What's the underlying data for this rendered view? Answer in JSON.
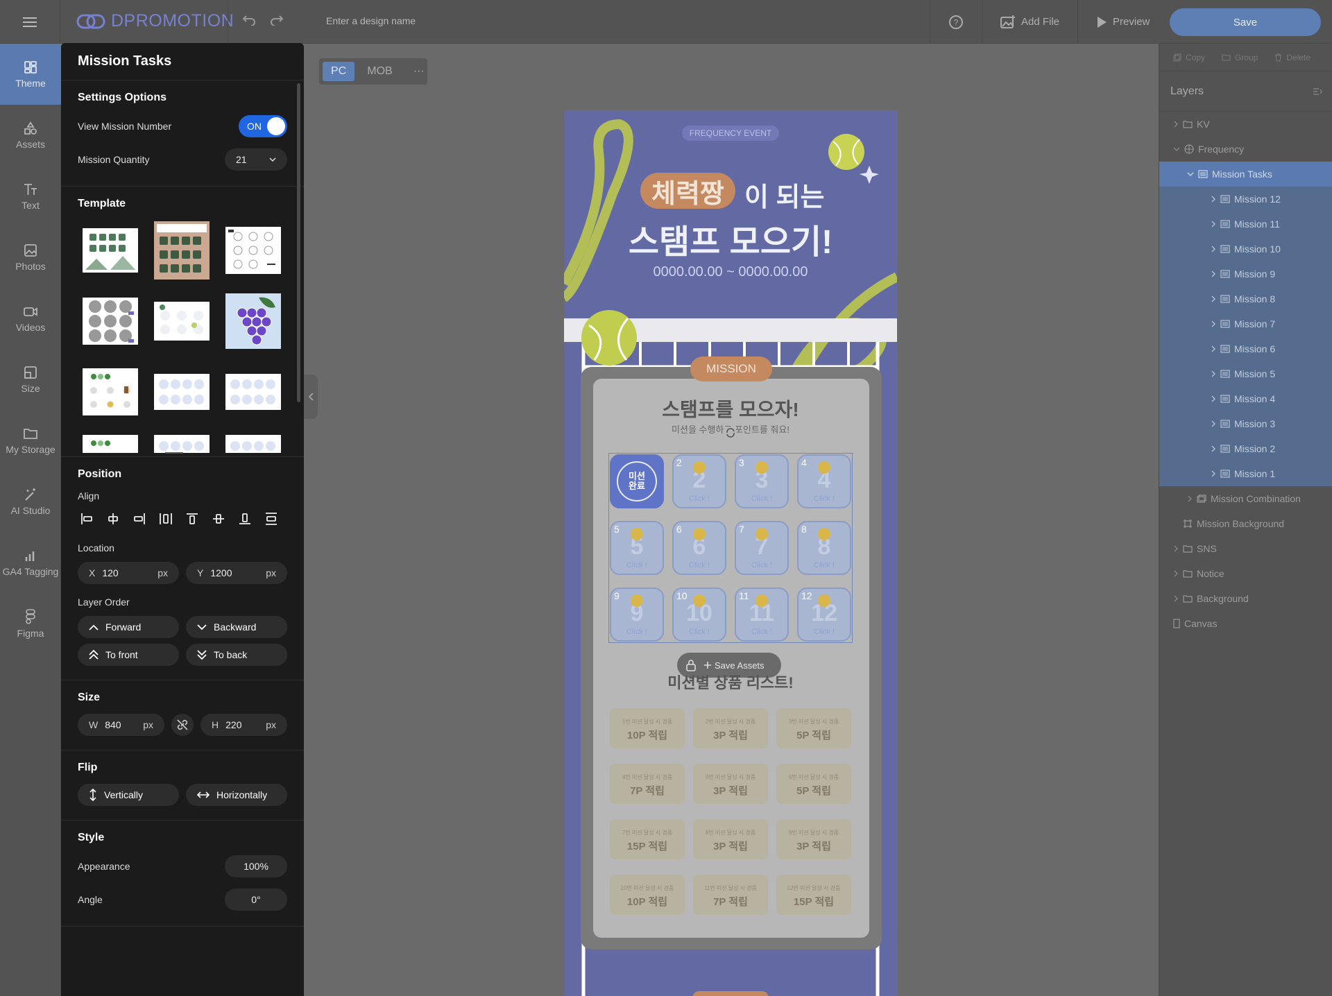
{
  "app": {
    "name": "DPROMOTION"
  },
  "topbar": {
    "design_name_placeholder": "Enter a design name",
    "add_file": "Add File",
    "preview": "Preview",
    "save": "Save"
  },
  "leftnav": {
    "items": [
      {
        "label": "Theme",
        "icon": "theme-icon"
      },
      {
        "label": "Assets",
        "icon": "assets-icon"
      },
      {
        "label": "Text",
        "icon": "text-icon"
      },
      {
        "label": "Photos",
        "icon": "photos-icon"
      },
      {
        "label": "Videos",
        "icon": "videos-icon"
      },
      {
        "label": "Size",
        "icon": "size-icon"
      },
      {
        "label": "My Storage",
        "icon": "folder-icon"
      },
      {
        "label": "AI Studio",
        "icon": "magic-wand-icon"
      },
      {
        "label": "GA4 Tagging",
        "icon": "bar-chart-icon"
      },
      {
        "label": "Figma",
        "icon": "figma-icon"
      }
    ]
  },
  "panel": {
    "title": "Mission Tasks",
    "settings": {
      "title": "Settings Options",
      "view_mission_number_label": "View Mission Number",
      "view_mission_number_state": "ON",
      "mission_quantity_label": "Mission Quantity",
      "mission_quantity_value": "21"
    },
    "template": {
      "title": "Template"
    },
    "position": {
      "title": "Position",
      "align_label": "Align",
      "location_label": "Location",
      "x_prefix": "X",
      "x_value": "120",
      "x_unit": "px",
      "y_prefix": "Y",
      "y_value": "1200",
      "y_unit": "px",
      "layer_order_label": "Layer Order",
      "forward": "Forward",
      "backward": "Backward",
      "to_front": "To front",
      "to_back": "To back"
    },
    "size": {
      "title": "Size",
      "w_prefix": "W",
      "w_value": "840",
      "w_unit": "px",
      "h_prefix": "H",
      "h_value": "220",
      "h_unit": "px"
    },
    "flip": {
      "title": "Flip",
      "vertically": "Vertically",
      "horizontally": "Horizontally"
    },
    "style": {
      "title": "Style",
      "appearance_label": "Appearance",
      "appearance_value": "100%",
      "angle_label": "Angle",
      "angle_value": "0°"
    }
  },
  "view_toggle": {
    "pc": "PC",
    "mob": "MOB",
    "more": "···"
  },
  "canvas": {
    "event_tag": "FREQUENCY EVENT",
    "headline_highlight": "체력짱",
    "headline_rest": "이 되는",
    "headline_line2": "스탬프 모으기!",
    "date_range": "0000.00.00 ~ 0000.00.00",
    "mission_tab": "MISSION",
    "card_title": "스탬프를 모으자!",
    "card_sub": "미션을 수행하고 포인트를 줘요!",
    "completed_stamp": "미션\n완료",
    "click_label": "Click !",
    "missions": [
      "2",
      "3",
      "4",
      "5",
      "6",
      "7",
      "8",
      "9",
      "10",
      "11",
      "12"
    ],
    "save_assets": "Save Assets",
    "list_title": "미션별 상품 리스트!",
    "rewards": [
      {
        "cond": "1번 미션 달성 시 경품",
        "prize": "10P 적립"
      },
      {
        "cond": "2번 미션 달성 시 경품",
        "prize": "3P 적립"
      },
      {
        "cond": "3번 미션 달성 시 경품",
        "prize": "5P 적립"
      },
      {
        "cond": "4번 미션 달성 시 경품",
        "prize": "7P 적립"
      },
      {
        "cond": "5번 미션 달성 시 경품",
        "prize": "3P 적립"
      },
      {
        "cond": "6번 미션 달성 시 경품",
        "prize": "5P 적립"
      },
      {
        "cond": "7번 미션 달성 시 경품",
        "prize": "15P 적립"
      },
      {
        "cond": "8번 미션 달성 시 경품",
        "prize": "3P 적립"
      },
      {
        "cond": "9번 미션 달성 시 경품",
        "prize": "3P 적립"
      },
      {
        "cond": "10번 미션 달성 시 경품",
        "prize": "10P 적립"
      },
      {
        "cond": "11번 미션 달성 시 경품",
        "prize": "7P 적립"
      },
      {
        "cond": "12번 미션 달성 시 경품",
        "prize": "15P 적립"
      }
    ]
  },
  "rightpanel": {
    "tools": {
      "copy": "Copy",
      "group": "Group",
      "delete": "Delete"
    },
    "layers_title": "Layers",
    "layers": {
      "kv": "KV",
      "frequency": "Frequency",
      "mission_tasks": "Mission Tasks",
      "missions": [
        "Mission 12",
        "Mission 11",
        "Mission 10",
        "Mission 9",
        "Mission 8",
        "Mission 7",
        "Mission 6",
        "Mission 5",
        "Mission 4",
        "Mission 3",
        "Mission 2",
        "Mission 1"
      ],
      "mission_combination": "Mission Combination",
      "mission_background": "Mission Background",
      "sns": "SNS",
      "notice": "Notice",
      "background": "Background",
      "canvas": "Canvas"
    }
  },
  "colors": {
    "accent": "#1f66e0",
    "save": "#5e7fb4",
    "canvas_bg": "#6269a3",
    "selected_layer": "#5b7bb0"
  }
}
